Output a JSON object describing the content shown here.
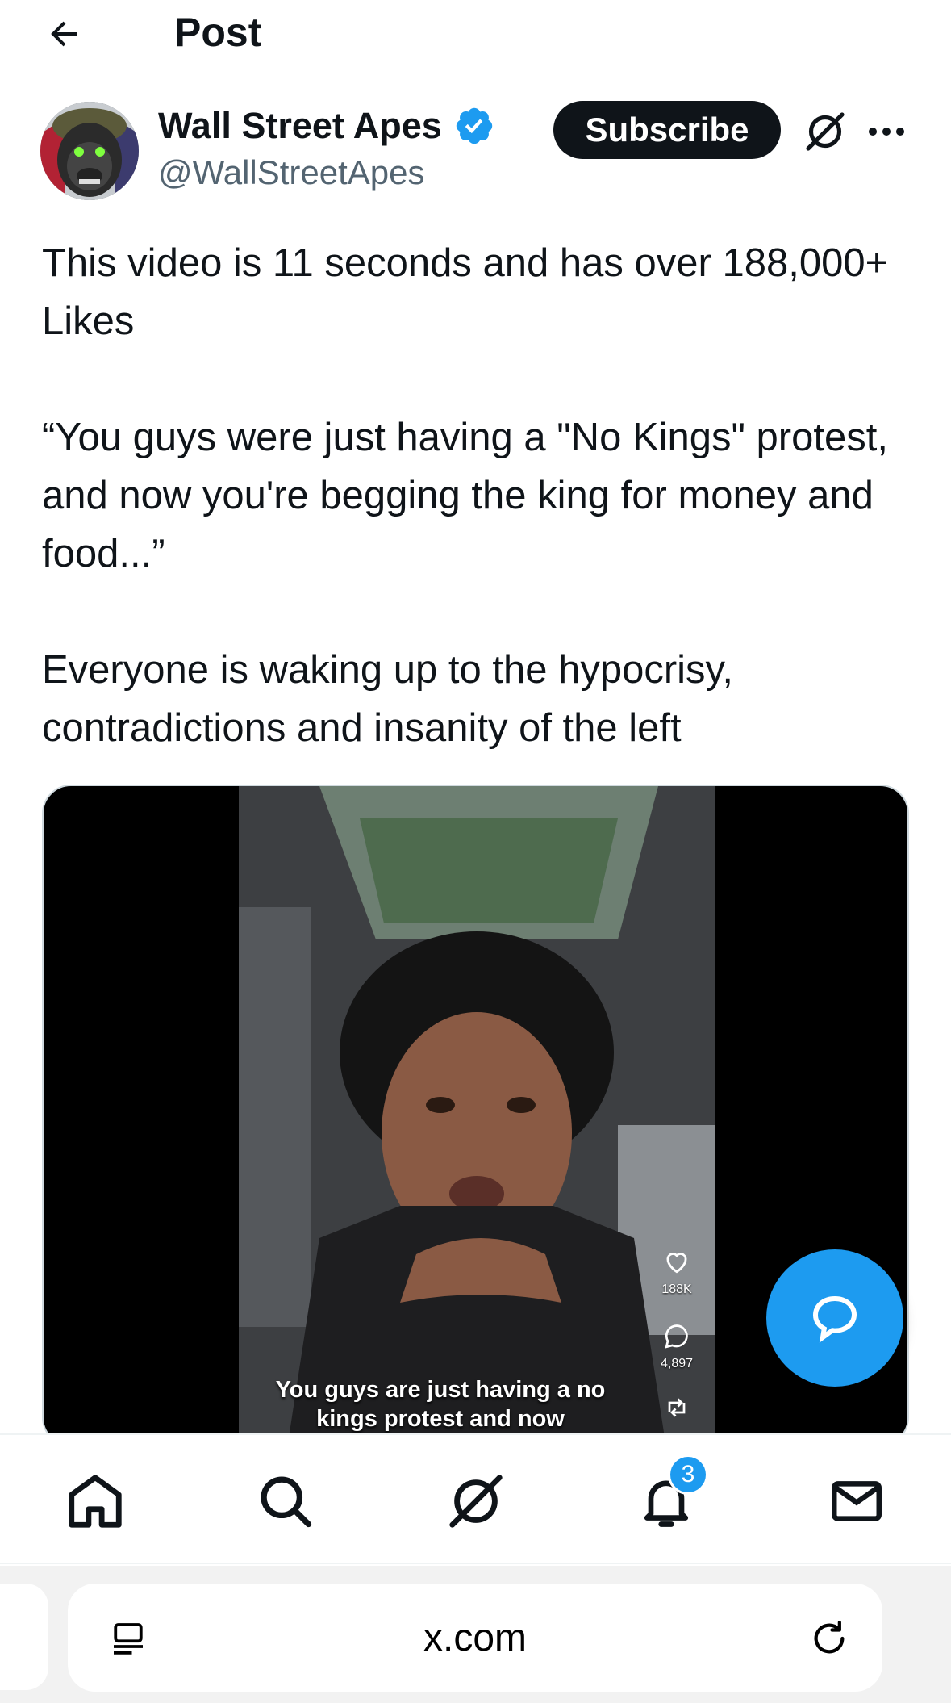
{
  "header": {
    "title": "Post"
  },
  "author": {
    "display_name": "Wall Street Apes",
    "handle": "@WallStreetApes",
    "subscribe_label": "Subscribe"
  },
  "post": {
    "paragraphs": [
      "This video is 11 seconds and has over 188,000+ Likes",
      "“You guys were just having a \"No Kings\" protest, and now you're begging the king for money and food...”",
      "Everyone is waking up to the hypocrisy, contradictions and insanity of the left"
    ]
  },
  "video": {
    "caption_line1": "You guys are just having a no",
    "caption_line2": "kings protest and now",
    "likes_count": "188K",
    "comments_count": "4,897"
  },
  "bottom_nav": {
    "items": [
      "home-icon",
      "search-icon",
      "grok-icon",
      "bell-icon",
      "mail-icon"
    ],
    "notifications_badge": "3"
  },
  "browser": {
    "url": "x.com"
  },
  "colors": {
    "accent": "#1d9bf0",
    "text": "#0f1419",
    "secondary": "#536471"
  }
}
